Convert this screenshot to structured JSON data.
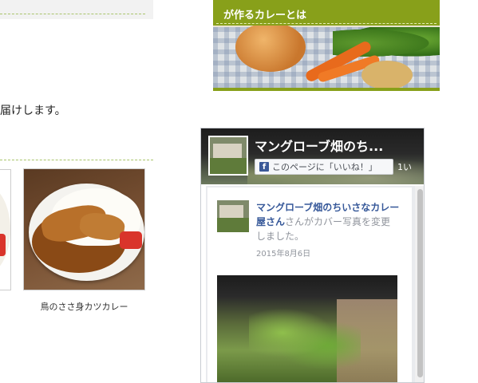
{
  "main": {
    "intro_text": "届けします。",
    "items": [
      {
        "caption": ""
      },
      {
        "caption": "鳥のささ身カツカレー"
      }
    ]
  },
  "sidebar": {
    "banner": {
      "title": "が作るカレーとは",
      "accent_color": "#88a01a"
    },
    "facebook": {
      "page_name": "マングローブ畑のち...",
      "like_label": "このページに「いいね！」",
      "like_count": "1い",
      "post": {
        "author": "マングローブ畑のちいさなカレー屋さん",
        "action": "さんがカバー写真を変更しました。",
        "date": "2015年8月6日"
      },
      "brand_color": "#3b5998",
      "link_color": "#365899"
    }
  }
}
